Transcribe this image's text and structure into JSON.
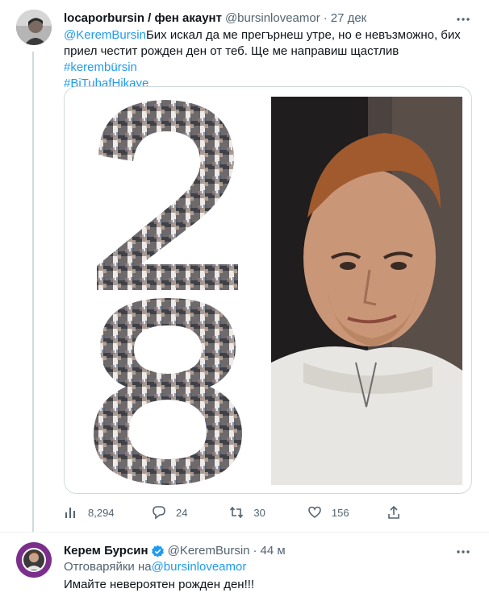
{
  "tweet1": {
    "display_name": "locaporbursin / фен акаунт",
    "handle": "@bursinloveamor",
    "separator": "·",
    "time": "27 дек",
    "mention": "@KeremBursin",
    "text_line1": "Бих искал да ме прегърнеш утре, но е невъзможно, бих",
    "text_line2": "приел честит рожден ден от теб. Ще ме направиш щастлив ",
    "hashtag1": "#kerembürsin",
    "hashtag2": "#BiTuhafHikaye",
    "media": {
      "collage_digits": "28",
      "alt": "photo collage and portrait"
    },
    "actions": {
      "views": "8,294",
      "replies": "24",
      "retweets": "30",
      "likes": "156"
    }
  },
  "tweet2": {
    "display_name": "Керем Бурсин",
    "handle": "@KeremBursin",
    "separator": "·",
    "time": "44 м",
    "reply_prefix": "Отговаряйки на",
    "reply_to": "@bursinloveamor",
    "text": "Имайте невероятен рожден ден!!!"
  },
  "colors": {
    "accent": "#1d9bf0",
    "muted": "#536471",
    "text": "#0f1419",
    "border": "#cfd9de"
  },
  "icons": [
    "more-icon",
    "views-icon",
    "reply-icon",
    "retweet-icon",
    "like-icon",
    "share-icon",
    "verified-icon"
  ]
}
